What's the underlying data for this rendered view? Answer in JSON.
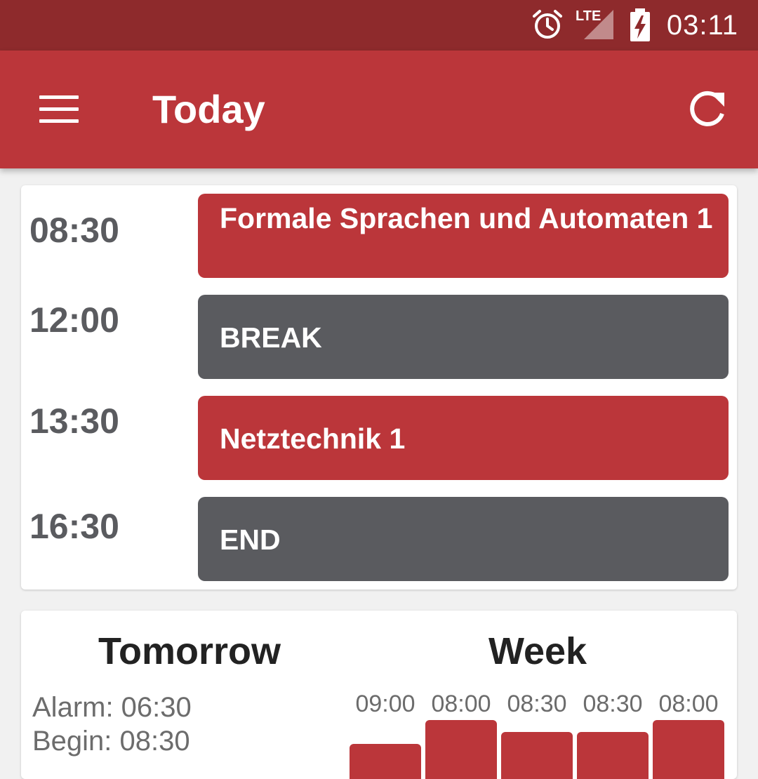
{
  "status_bar": {
    "time": "03:11",
    "network": "LTE",
    "icons": [
      "alarm-clock-icon",
      "lte-signal-icon",
      "battery-charging-icon"
    ]
  },
  "app_bar": {
    "title": "Today",
    "menu_icon": "hamburger-menu-icon",
    "refresh_icon": "refresh-icon"
  },
  "colors": {
    "primary": "#bb363a",
    "primary_dark": "#8e2a2c",
    "neutral_block": "#5a5b5f"
  },
  "schedule": [
    {
      "time": "08:30",
      "title": "Formale Sprachen und Automaten 1",
      "kind": "lecture"
    },
    {
      "time": "12:00",
      "title": "BREAK",
      "kind": "break"
    },
    {
      "time": "13:30",
      "title": "Netztechnik 1",
      "kind": "lecture"
    },
    {
      "time": "16:30",
      "title": "END",
      "kind": "end"
    }
  ],
  "tomorrow": {
    "heading": "Tomorrow",
    "alarm": "Alarm: 06:30",
    "begin": "Begin: 08:30"
  },
  "week": {
    "heading": "Week",
    "days": [
      {
        "time": "09:00"
      },
      {
        "time": "08:00"
      },
      {
        "time": "08:30"
      },
      {
        "time": "08:30"
      },
      {
        "time": "08:00"
      }
    ]
  }
}
